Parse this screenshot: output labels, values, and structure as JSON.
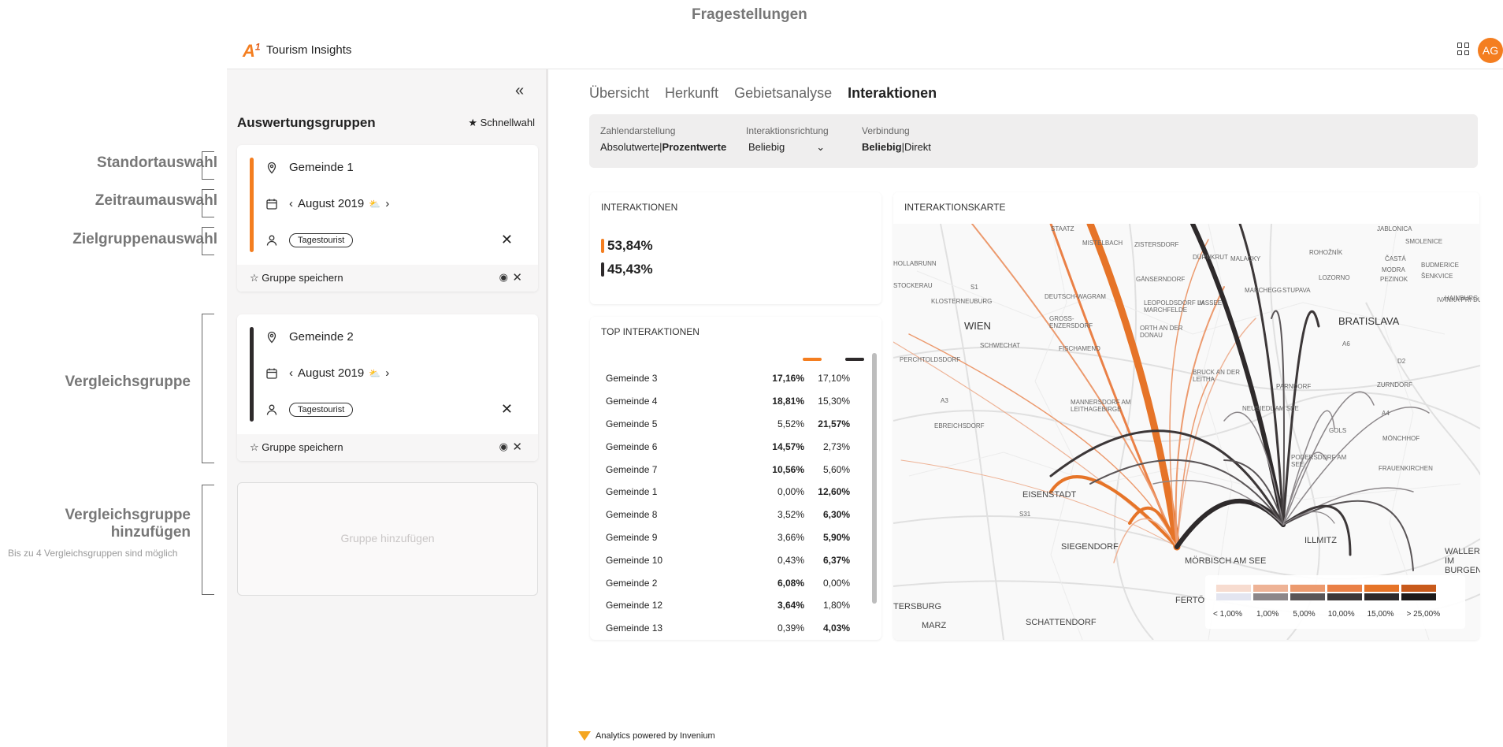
{
  "annotations": {
    "top_label": "Fragestellungen",
    "standort": "Standortauswahl",
    "zeitraum": "Zeitraumauswahl",
    "zielgruppe": "Zielgruppenauswahl",
    "vergleich": "Vergleichsgruppe",
    "vergleich_add_1": "Vergleichsgruppe",
    "vergleich_add_2": "hinzufügen",
    "vergleich_note": "Bis zu 4 Vergleichsgruppen sind möglich"
  },
  "header": {
    "logo": "A",
    "logo_sup": "1",
    "app_name": "Tourism Insights",
    "avatar_initials": "AG",
    "apps_icon": "apps-grid-icon"
  },
  "sidebar": {
    "collapse_label": "«",
    "title": "Auswertungsgruppen",
    "quick_label": "Schnellwahl",
    "groups": [
      {
        "color": "#f47e20",
        "location": "Gemeinde 1",
        "period": "August 2019",
        "audience": "Tagestourist",
        "save_label": "Gruppe speichern"
      },
      {
        "color": "#2e2a2b",
        "location": "Gemeinde 2",
        "period": "August 2019",
        "audience": "Tagestourist",
        "save_label": "Gruppe speichern"
      }
    ],
    "add_group_label": "Gruppe hinzufügen"
  },
  "tabs": [
    {
      "label": "Übersicht",
      "active": false
    },
    {
      "label": "Herkunft",
      "active": false
    },
    {
      "label": "Gebietsanalyse",
      "active": false
    },
    {
      "label": "Interaktionen",
      "active": true
    }
  ],
  "filters": {
    "zahlendarstellung": {
      "label": "Zahlendarstellung",
      "option_a": "Absolutwerte",
      "option_b": "Prozentwerte"
    },
    "richtung": {
      "label": "Interaktionsrichtung",
      "value": "Beliebig"
    },
    "verbindung": {
      "label": "Verbindung",
      "option_a": "Beliebig",
      "option_b": "Direkt"
    }
  },
  "interaktionen": {
    "title": "INTERAKTIONEN",
    "values": [
      {
        "value": "53,84%",
        "color": "#f47e20"
      },
      {
        "value": "45,43%",
        "color": "#2e2a2b"
      }
    ]
  },
  "top_interaktionen": {
    "title": "TOP INTERAKTIONEN",
    "rows": [
      {
        "name": "Gemeinde 3",
        "v1": "17,16%",
        "v2": "17,10%",
        "bold": 1
      },
      {
        "name": "Gemeinde 4",
        "v1": "18,81%",
        "v2": "15,30%",
        "bold": 1
      },
      {
        "name": "Gemeinde 5",
        "v1": "5,52%",
        "v2": "21,57%",
        "bold": 2
      },
      {
        "name": "Gemeinde 6",
        "v1": "14,57%",
        "v2": "2,73%",
        "bold": 1
      },
      {
        "name": "Gemeinde 7",
        "v1": "10,56%",
        "v2": "5,60%",
        "bold": 1
      },
      {
        "name": "Gemeinde 1",
        "v1": "0,00%",
        "v2": "12,60%",
        "bold": 2
      },
      {
        "name": "Gemeinde 8",
        "v1": "3,52%",
        "v2": "6,30%",
        "bold": 2
      },
      {
        "name": "Gemeinde 9",
        "v1": "3,66%",
        "v2": "5,90%",
        "bold": 2
      },
      {
        "name": "Gemeinde 10",
        "v1": "0,43%",
        "v2": "6,37%",
        "bold": 2
      },
      {
        "name": "Gemeinde 2",
        "v1": "6,08%",
        "v2": "0,00%",
        "bold": 1
      },
      {
        "name": "Gemeinde 12",
        "v1": "3,64%",
        "v2": "1,80%",
        "bold": 1
      },
      {
        "name": "Gemeinde 13",
        "v1": "0,39%",
        "v2": "4,03%",
        "bold": 2
      }
    ]
  },
  "map": {
    "title": "INTERAKTIONSKARTE",
    "places": [
      "WIEN",
      "BRATISLAVA",
      "EISENSTADT",
      "MÖRBISCH AM SEE",
      "ILLMITZ",
      "SIEGENDORF",
      "SCHATTENDORF",
      "MARZ",
      "TERSBURG",
      "FERTÖ",
      "GOLS",
      "MÖNCHHOF",
      "FRAUENKIRCHEN",
      "ZURNDORF",
      "SCHWECHAT",
      "FISCHAMEND",
      "EBREICHSDORF",
      "MANNERSDORF AM LEITHAGEBIRGE",
      "NEUSIEDL AM SEE",
      "PODERSDORF AM SEE",
      "PERCHTOLDSDORF",
      "KLOSTERNEUBURG",
      "GROSS-ENZERSDORF",
      "DEUTSCH-WAGRAM",
      "STOCKERAU",
      "HOLLABRUNN",
      "STAATZ",
      "MISTELBACH",
      "ZISTERSDORF",
      "DÜRNKRUT",
      "MALACKY",
      "STUPAVA",
      "LOZORNO",
      "ROHOŽNÍK",
      "JABLONICA",
      "SMOLENICE",
      "ČASTÁ",
      "MODRA",
      "PEZINOK",
      "BUDMERICE",
      "ŠENKVICE",
      "IVANKA PRI DUNAJI",
      "MARCHEGG",
      "LASSEE",
      "GÄNSERNDORF",
      "LEOPOLDSDORF IM MARCHFELDE",
      "ORTH AN DER DONAU",
      "BRUCK AN DER LEITHA",
      "PARNDORF",
      "WALLERN IM BURGENLAND",
      "HAINBURG",
      "A6",
      "A4",
      "A3",
      "S31",
      "S1",
      "D2"
    ],
    "legend_labels": [
      "< 1,00%",
      "1,00%",
      "5,00%",
      "10,00%",
      "15,00%",
      "> 25,00%"
    ],
    "legend_orange": [
      "#f7dcd0",
      "#eeb396",
      "#ec9a6e",
      "#ea8046",
      "#e67428",
      "#c85a1b"
    ],
    "legend_dark": [
      "#e3e5f0",
      "#8c878a",
      "#5a5557",
      "#3c3738",
      "#2e2a2b",
      "#1c1a1a"
    ]
  },
  "footer": {
    "text": "Analytics powered by Invenium"
  }
}
